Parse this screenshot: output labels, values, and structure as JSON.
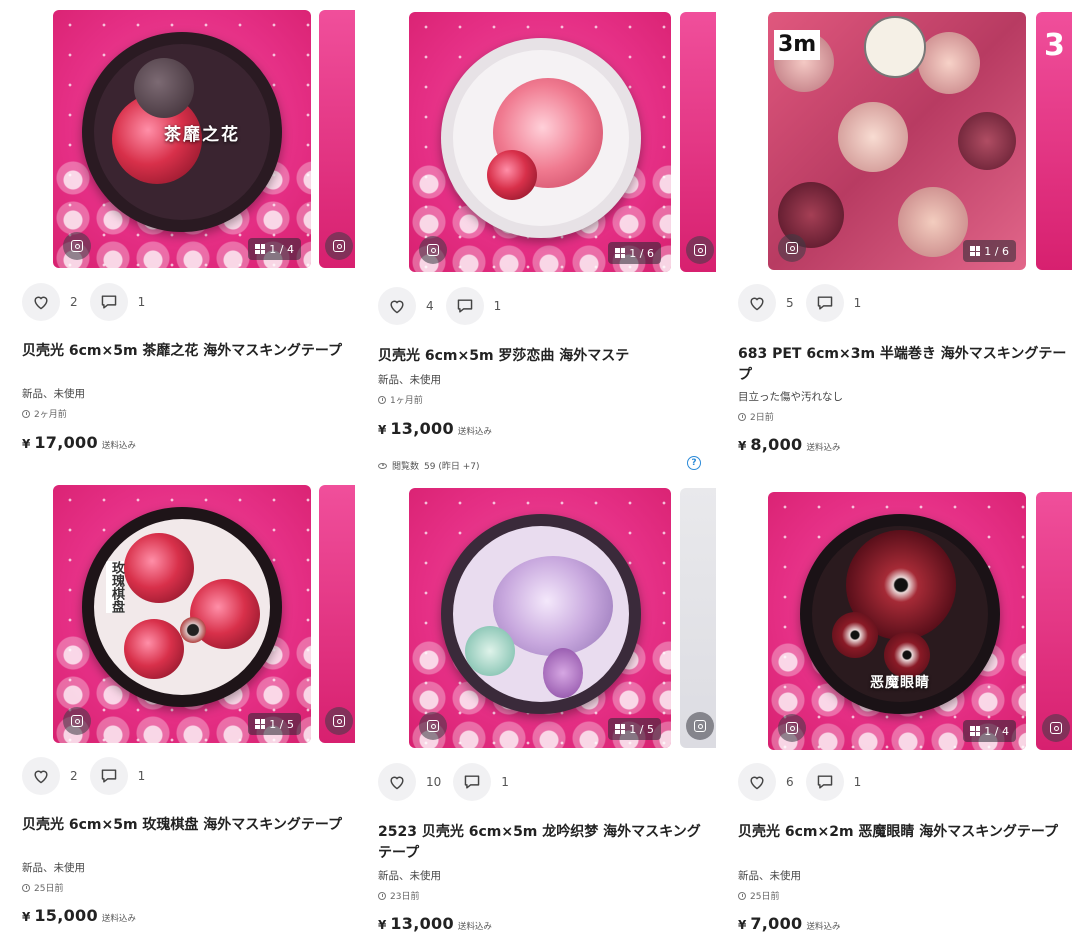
{
  "products": [
    {
      "tape_title": "茶靡之花",
      "image_counter": "1 / 4",
      "likes": "2",
      "comments": "1",
      "name": "贝壳光 6cm×5m 茶靡之花 海外マスキングテープ",
      "condition": "新品、未使用",
      "listed": "2ヶ月前",
      "price": "17,000",
      "shipping": "送料込み",
      "colors": {
        "face": "#3a2430",
        "rose": "#c1273f"
      }
    },
    {
      "tape_title": "",
      "image_counter": "1 / 6",
      "likes": "4",
      "comments": "1",
      "name": "贝壳光 6cm×5m 罗莎恋曲 海外マステ",
      "condition": "新品、未使用",
      "listed": "1ヶ月前",
      "price": "13,000",
      "shipping": "送料込み",
      "views_label": "閲覧数",
      "views": "59 (昨日 +7)",
      "help": "?",
      "colors": {
        "face": "#f5f2f4",
        "rose": "#f07a90"
      }
    },
    {
      "tape_title": "",
      "badge": "3m",
      "peek_badge": "3",
      "image_counter": "1 / 6",
      "likes": "5",
      "comments": "1",
      "name": "683 PET 6cm×3m 半端巻き 海外マスキングテープ",
      "condition": "目立った傷や汚れなし",
      "listed": "2日前",
      "price": "8,000",
      "shipping": "送料込み",
      "colors": {
        "face": "#d9a0a5",
        "rose": "#a52c49"
      }
    },
    {
      "tape_title": "玫瑰棋盘",
      "image_counter": "1 / 5",
      "likes": "2",
      "comments": "1",
      "name": "贝壳光 6cm×5m 玫瑰棋盘 海外マスキングテープ",
      "condition": "新品、未使用",
      "listed": "25日前",
      "price": "15,000",
      "shipping": "送料込み",
      "colors": {
        "face": "#f2e9ea",
        "rose": "#d8222f"
      }
    },
    {
      "tape_title": "",
      "image_counter": "1 / 5",
      "likes": "10",
      "comments": "1",
      "name": "2523 贝壳光 6cm×5m 龙吟织梦 海外マスキングテープ",
      "condition": "新品、未使用",
      "listed": "23日前",
      "price": "13,000",
      "shipping": "送料込み",
      "colors": {
        "face": "#e9dcef",
        "rose": "#b58fd0"
      }
    },
    {
      "tape_title": "恶魔眼睛",
      "image_counter": "1 / 4",
      "likes": "6",
      "comments": "1",
      "name": "贝壳光 6cm×2m 恶魔眼睛 海外マスキングテープ",
      "condition": "新品、未使用",
      "listed": "25日前",
      "price": "7,000",
      "shipping": "送料込み",
      "colors": {
        "face": "#2a1a1e",
        "rose": "#8f1524"
      }
    }
  ],
  "currency": "¥",
  "icons": {
    "like": "heart-icon",
    "comment": "comment-icon",
    "scan": "image-search-icon",
    "gallery": "gallery-grid-icon",
    "clock": "clock-icon",
    "views": "eye-icon"
  }
}
